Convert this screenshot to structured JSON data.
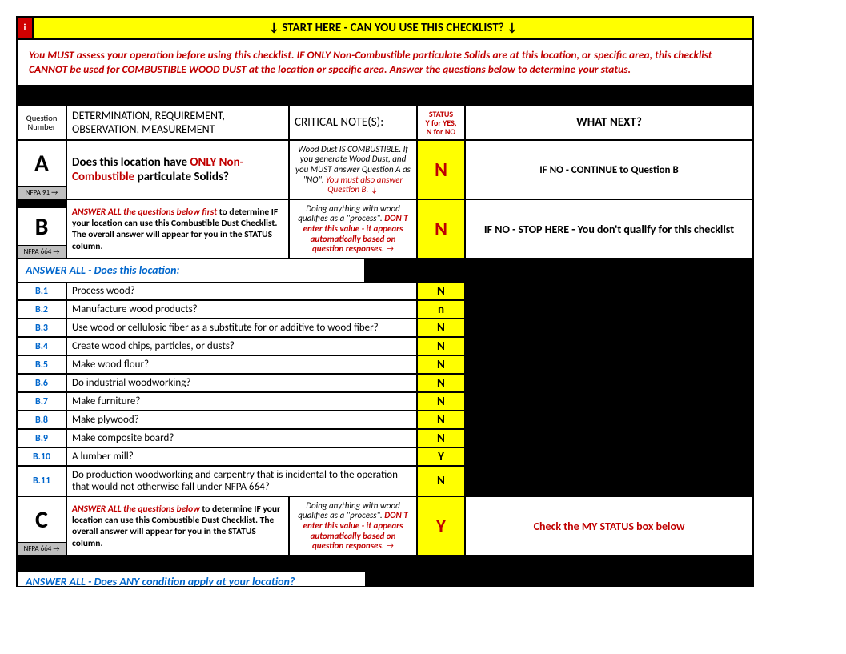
{
  "banner": {
    "i": "i",
    "title": "↓  START HERE - CAN YOU USE THIS CHECKLIST?  ↓"
  },
  "intro": "You MUST assess your operation before using this checklist. IF ONLY Non-Combustible particulate Solids are at this location, or specific area, this checklist CANNOT be used for COMBUSTIBLE WOOD DUST at the location or specific area. Answer the questions below to determine your status.",
  "headers": {
    "qnum": "Question Number",
    "det": "DETERMINATION, REQUIREMENT, OBSERVATION, MEASUREMENT",
    "crit": "CRITICAL NOTE(S):",
    "stat1": "STATUS",
    "stat2": "Y for YES,",
    "stat3": "N for NO",
    "next": "WHAT NEXT?"
  },
  "rowA": {
    "letter": "A",
    "nfpa": "NFPA 91 →",
    "det_prefix": "Does this location have ",
    "det_red": "ONLY Non-Combustible",
    "det_suffix": " particulate Solids?",
    "crit_plain": "Wood Dust IS COMBUSTIBLE. If you generate Wood Dust, and you MUST answer Question A as \"NO\".",
    "crit_red": " You must also answer Question B. ↓",
    "status": "N",
    "next": "IF NO - CONTINUE to Question B"
  },
  "rowB": {
    "letter": "B",
    "nfpa": "NFPA 664 →",
    "det_red": "ANSWER ALL the questions below first",
    "det_rest": " to determine IF your location can use this Combustible Dust Checklist. The overall answer will appear for you in the STATUS column.",
    "crit_plain": "Doing anything with wood qualifies as a \"process\".",
    "crit_red": "  DON'T enter this value - it appears automatically based on question responses",
    "crit_arrow": ". →",
    "status": "N",
    "next": "IF NO - STOP HERE - You don't qualify for this checklist"
  },
  "bheader": "ANSWER ALL - Does this location:",
  "bitems": [
    {
      "num": "B.1",
      "txt": "Process wood?",
      "stat": "N"
    },
    {
      "num": "B.2",
      "txt": "Manufacture wood products?",
      "stat": "n"
    },
    {
      "num": "B.3",
      "txt": "Use wood or cellulosic fiber as a substitute for or additive to wood fiber?",
      "stat": "N"
    },
    {
      "num": "B.4",
      "txt": "Create wood chips, particles, or dusts?",
      "stat": "N"
    },
    {
      "num": "B.5",
      "txt": "Make wood flour?",
      "stat": "N"
    },
    {
      "num": "B.6",
      "txt": "Do industrial woodworking?",
      "stat": "N"
    },
    {
      "num": "B.7",
      "txt": "Make furniture?",
      "stat": "N"
    },
    {
      "num": "B.8",
      "txt": "Make plywood?",
      "stat": "N"
    },
    {
      "num": "B.9",
      "txt": "Make composite board?",
      "stat": "N"
    },
    {
      "num": "B.10",
      "txt": "A lumber mill?",
      "stat": "Y"
    },
    {
      "num": "B.11",
      "txt": "Do production woodworking and carpentry that is incidental to the operation that would not otherwise fall under NFPA 664?",
      "stat": "N"
    }
  ],
  "rowC": {
    "letter": "C",
    "nfpa": "NFPA 664 →",
    "det_red": "ANSWER ALL the questions below",
    "det_rest": " to determine IF your location can use this Combustible Dust Checklist. The overall answer will appear for you in the STATUS column.",
    "crit_plain": "Doing anything with wood qualifies as a \"process\".",
    "crit_red": "  DON'T enter this value - it appears automatically based on question responses",
    "crit_arrow": ". →",
    "status": "Y",
    "next": "Check the MY STATUS box below"
  },
  "bottom_blue": "ANSWER ALL - Does ANY condition apply at your location?"
}
